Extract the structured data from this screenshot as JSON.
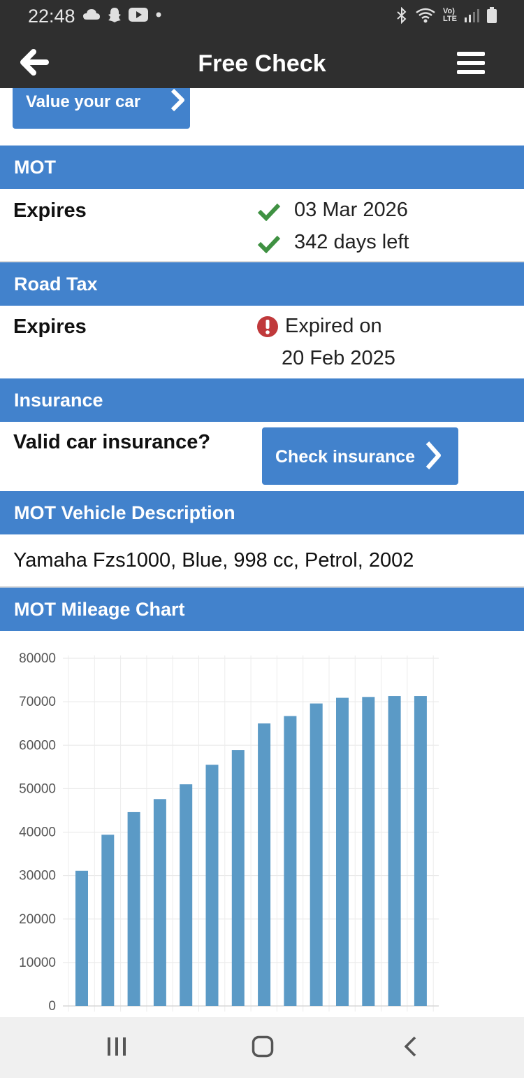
{
  "status_bar": {
    "time": "22:48",
    "left_icons": [
      "cloud-icon",
      "snapchat-icon",
      "youtube-icon",
      "dot-icon"
    ],
    "right_icons": [
      "bluetooth-icon",
      "wifi-icon",
      "volte-icon",
      "signal-icon",
      "battery-icon"
    ],
    "volte_text_top": "Vo)",
    "volte_text_bottom": "LTE"
  },
  "app_bar": {
    "title": "Free Check",
    "back_icon": "arrow-left-icon",
    "menu_icon": "hamburger-menu-icon"
  },
  "value_button": {
    "label": "Value your car"
  },
  "mot": {
    "heading": "MOT",
    "label": "Expires",
    "date": "03 Mar 2026",
    "days_left": "342 days left"
  },
  "road_tax": {
    "heading": "Road Tax",
    "label": "Expires",
    "status_line1": "Expired on",
    "status_line2": "20 Feb 2025"
  },
  "insurance": {
    "heading": "Insurance",
    "label": "Valid car insurance?",
    "button": "Check insurance"
  },
  "vehicle_description": {
    "heading": "MOT Vehicle Description",
    "text": "Yamaha Fzs1000, Blue, 998 cc, Petrol, 2002"
  },
  "mileage_chart": {
    "heading": "MOT Mileage Chart"
  },
  "colors": {
    "accent": "#4282cc",
    "bar": "#5b9ac6",
    "check_green": "#3f9142",
    "alert_red": "#c0393b",
    "dark_bar": "#2f2f2f"
  },
  "chart_data": {
    "type": "bar",
    "title": "",
    "xlabel": "",
    "ylabel": "",
    "ylim": [
      0,
      80000
    ],
    "yticks": [
      "80000",
      "70000",
      "60000",
      "50000",
      "40000",
      "30000",
      "20000",
      "10000",
      "0"
    ],
    "grid": true,
    "values": [
      31100,
      39400,
      44600,
      47600,
      51000,
      55500,
      58900,
      65000,
      66700,
      69600,
      70900,
      71100,
      71300,
      71300
    ]
  },
  "nav_bar": {
    "buttons": [
      "recents-icon",
      "home-icon",
      "back-icon"
    ]
  }
}
